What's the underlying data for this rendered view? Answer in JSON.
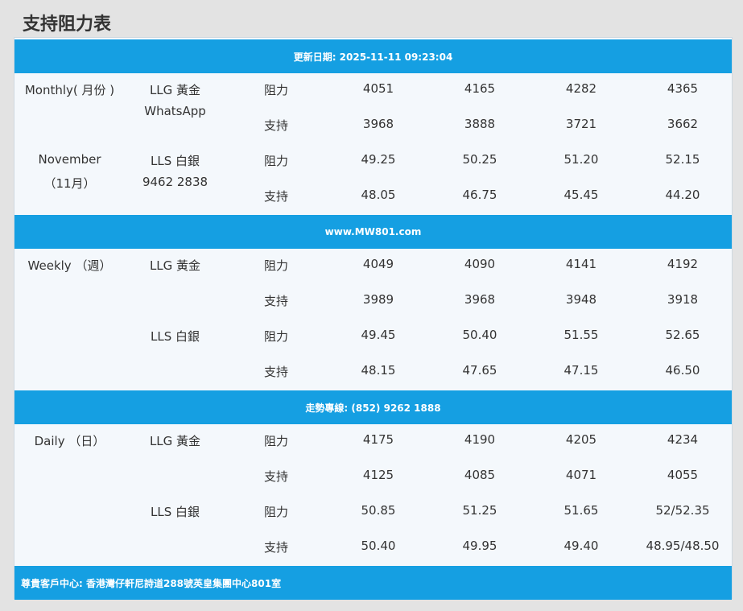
{
  "title": "支持阻力表",
  "bands": {
    "update": "更新日期: 2025-11-11 09:23:04",
    "website": "www.MW801.com",
    "hotline": "走勢專線: (852) 9262 1888",
    "address": "尊貴客戶中心: 香港灣仔軒尼詩道288號英皇集團中心801室"
  },
  "sections": [
    {
      "period_lines": [
        "Monthly( 月份 )",
        "",
        "November",
        "（11月）"
      ],
      "product_lines": [
        "LLG 黃金",
        "WhatsApp",
        "LLS 白銀",
        "9462 2838"
      ],
      "rows": [
        {
          "type": "阻力",
          "values": [
            "4051",
            "4165",
            "4282",
            "4365"
          ]
        },
        {
          "type": "支持",
          "values": [
            "3968",
            "3888",
            "3721",
            "3662"
          ]
        },
        {
          "type": "阻力",
          "values": [
            "49.25",
            "50.25",
            "51.20",
            "52.15"
          ]
        },
        {
          "type": "支持",
          "values": [
            "48.05",
            "46.75",
            "45.45",
            "44.20"
          ]
        }
      ]
    },
    {
      "period_lines": [
        "Weekly （週）",
        "",
        "",
        ""
      ],
      "product_lines": [
        "LLG 黃金",
        "",
        "LLS 白銀",
        ""
      ],
      "rows": [
        {
          "type": "阻力",
          "values": [
            "4049",
            "4090",
            "4141",
            "4192"
          ]
        },
        {
          "type": "支持",
          "values": [
            "3989",
            "3968",
            "3948",
            "3918"
          ]
        },
        {
          "type": "阻力",
          "values": [
            "49.45",
            "50.40",
            "51.55",
            "52.65"
          ]
        },
        {
          "type": "支持",
          "values": [
            "48.15",
            "47.65",
            "47.15",
            "46.50"
          ]
        }
      ]
    },
    {
      "period_lines": [
        "Daily （日）",
        "",
        "",
        ""
      ],
      "product_lines": [
        "LLG 黃金",
        "",
        "LLS 白銀",
        ""
      ],
      "rows": [
        {
          "type": "阻力",
          "values": [
            "4175",
            "4190",
            "4205",
            "4234"
          ]
        },
        {
          "type": "支持",
          "values": [
            "4125",
            "4085",
            "4071",
            "4055"
          ]
        },
        {
          "type": "阻力",
          "values": [
            "50.85",
            "51.25",
            "51.65",
            "52/52.35"
          ]
        },
        {
          "type": "支持",
          "values": [
            "50.40",
            "49.95",
            "49.40",
            "48.95/48.50"
          ]
        }
      ]
    }
  ],
  "colors": {
    "band": "#159fe2",
    "table_bg": "#f4f8fc",
    "page_bg": "#e3e3e3"
  }
}
